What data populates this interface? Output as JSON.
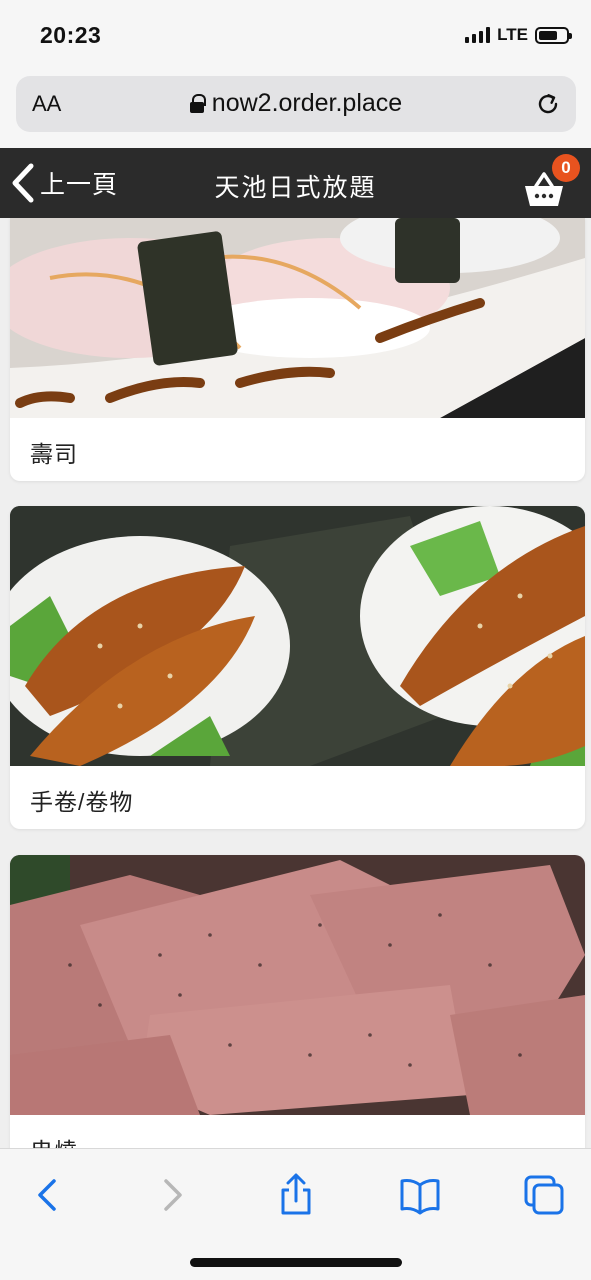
{
  "status_bar": {
    "time": "20:23",
    "network": "LTE"
  },
  "browser": {
    "text_size_label": "AA",
    "url": "now2.order.place"
  },
  "header": {
    "back_label": "上一頁",
    "title": "天池日式放題",
    "cart_count": "0",
    "bg_color": "#2b2b2b",
    "badge_color": "#e8531f"
  },
  "categories": [
    {
      "label": "壽司",
      "image_icon": "sushi-photo"
    },
    {
      "label": "手卷/卷物",
      "image_icon": "hand-roll-photo"
    },
    {
      "label": "串燒",
      "image_icon": "beef-tongue-photo"
    }
  ],
  "toolbar": {
    "icons": [
      "back-icon",
      "forward-icon",
      "share-icon",
      "bookmarks-icon",
      "tabs-icon"
    ]
  }
}
